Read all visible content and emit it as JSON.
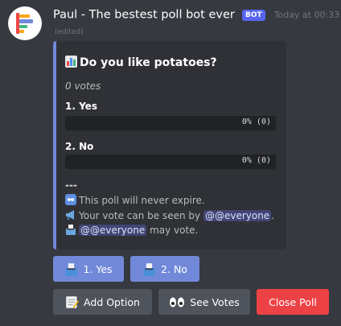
{
  "message": {
    "author": "Paul - The bestest poll bot ever",
    "badge": "BOT",
    "timestamp": "Today at 00:33",
    "edited": "(edited)"
  },
  "embed": {
    "accent_color": "#7289da",
    "title": "Do you like potatoes?",
    "title_icon": "bar-chart-icon",
    "vote_count": "0 votes",
    "options": [
      {
        "label": "1. Yes",
        "percent_text": "0% (0)",
        "fraction": 0
      },
      {
        "label": "2. No",
        "percent_text": "0% (0)",
        "fraction": 0
      }
    ],
    "separator": "---",
    "footer": {
      "expire": {
        "icon": "infinity-icon",
        "text": "This poll will never expire."
      },
      "visibility": {
        "icon": "megaphone-icon",
        "text_before": "Your vote can be seen by",
        "mention": "@@everyone",
        "text_after": "."
      },
      "voters": {
        "icon": "ballot-box-icon",
        "mention": "@@everyone",
        "text_after": "may vote."
      }
    }
  },
  "vote_buttons": [
    {
      "label": "1. Yes",
      "icon": "ballot-box-icon"
    },
    {
      "label": "2. No",
      "icon": "ballot-box-icon"
    }
  ],
  "action_buttons": {
    "add_option": {
      "label": "Add Option",
      "icon": "memo-icon",
      "color": "#4f545c"
    },
    "see_votes": {
      "label": "See Votes",
      "icon": "eyes-icon",
      "color": "#4f545c"
    },
    "close_poll": {
      "label": "Close Poll",
      "color": "#ed4245"
    }
  },
  "colors": {
    "background": "#36393f",
    "embed_background": "#2f3136",
    "blurple": "#7289da",
    "danger": "#ed4245"
  }
}
